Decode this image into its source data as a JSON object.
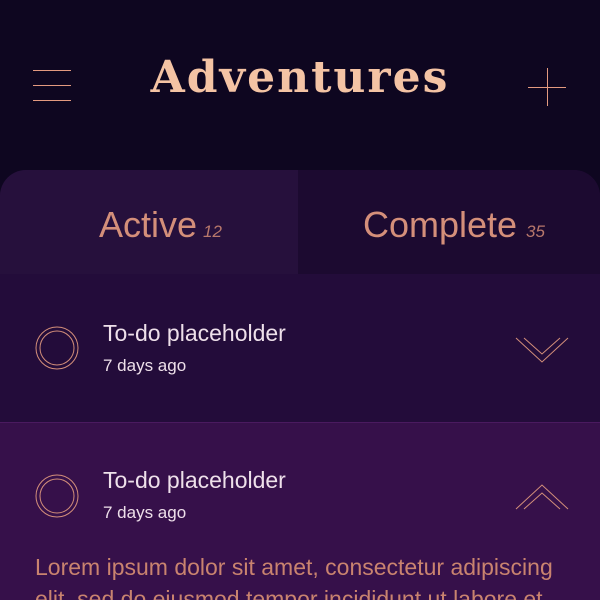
{
  "header": {
    "title": "Adventures",
    "menu_icon": "hamburger-menu-icon",
    "add_icon": "plus-icon"
  },
  "tabs": [
    {
      "label": "Active",
      "count": "12",
      "selected": true
    },
    {
      "label": "Complete",
      "count": "35",
      "selected": false
    }
  ],
  "todos": [
    {
      "title": "To-do placeholder",
      "time": "7 days ago",
      "expanded": false,
      "icon": "chevron-down-icon"
    },
    {
      "title": "To-do placeholder",
      "time": "7 days ago",
      "expanded": true,
      "icon": "chevron-up-icon",
      "description": "Lorem ipsum dolor sit amet, consectetur adipiscing elit, sed do eiusmod tempor incididunt ut labore et"
    }
  ],
  "colors": {
    "background": "#0e0620",
    "panel": "#220b38",
    "expanded_row": "#36104a",
    "title": "#f4c3a4",
    "accent": "#e39a80",
    "text": "#eee0ea"
  }
}
